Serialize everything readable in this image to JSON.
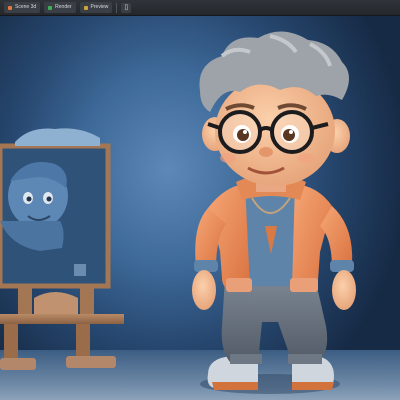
{
  "toolbar": {
    "buttons": [
      {
        "label": "Scene 3d",
        "color": "#e07a3a"
      },
      {
        "label": "Render",
        "color": "#3fae5a"
      },
      {
        "label": "Preview",
        "color": "#d0a43a"
      }
    ]
  },
  "scene": {
    "colors": {
      "backdrop": "#3f6b9b",
      "jacket": "#ef8e5a",
      "shirt": "#5d82a8",
      "pants": "#6a7480",
      "hair": "#9ea3a8",
      "skin": "#f2b98f",
      "wood": "#a47754"
    }
  }
}
